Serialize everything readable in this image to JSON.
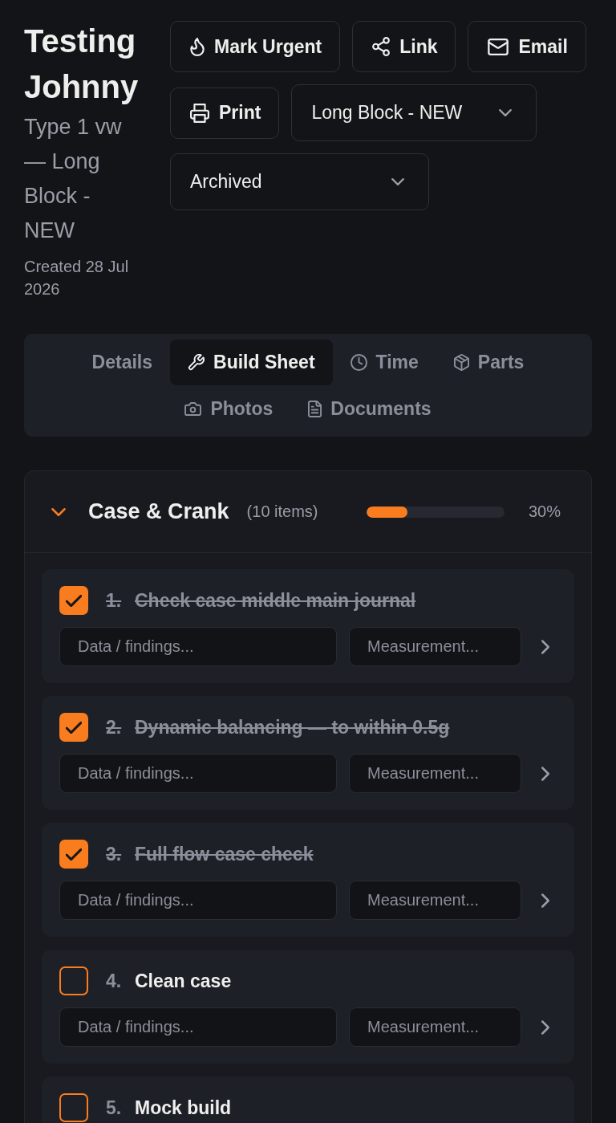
{
  "header": {
    "title": "Testing Johnny",
    "subtitle": "Type 1 vw — Long Block - NEW",
    "created": "Created 28 Jul 2026"
  },
  "actions": [
    {
      "kind": "button",
      "label": "Mark Urgent"
    },
    {
      "kind": "button",
      "label": "Link"
    },
    {
      "kind": "button",
      "label": "Email"
    },
    {
      "kind": "button",
      "label": "Print"
    },
    {
      "kind": "select",
      "value": "Long Block - NEW"
    },
    {
      "kind": "select",
      "value": "Archived"
    }
  ],
  "tabs": [
    {
      "label": "Details",
      "selected": false
    },
    {
      "label": "Build Sheet",
      "selected": true
    },
    {
      "label": "Time",
      "selected": false
    },
    {
      "label": "Parts",
      "selected": false
    },
    {
      "label": "Photos",
      "selected": false
    },
    {
      "label": "Documents",
      "selected": false
    }
  ],
  "section": {
    "title": "Case & Crank",
    "count": "(10 items)",
    "expanded": true,
    "level": 0.3,
    "percent": "30%",
    "items": [
      {
        "number": "1.",
        "title": "Check case middle main journal",
        "checked": true,
        "data_placeholder": "Data / findings...",
        "measurement_placeholder": "Measurement..."
      },
      {
        "number": "2.",
        "title": "Dynamic balancing — to within 0.5g",
        "checked": true,
        "data_placeholder": "Data / findings...",
        "measurement_placeholder": "Measurement..."
      },
      {
        "number": "3.",
        "title": "Full flow case check",
        "checked": true,
        "data_placeholder": "Data / findings...",
        "measurement_placeholder": "Measurement..."
      },
      {
        "number": "4.",
        "title": "Clean case",
        "checked": false,
        "data_placeholder": "Data / findings...",
        "measurement_placeholder": "Measurement..."
      },
      {
        "number": "5.",
        "title": "Mock build",
        "checked": false
      }
    ]
  }
}
